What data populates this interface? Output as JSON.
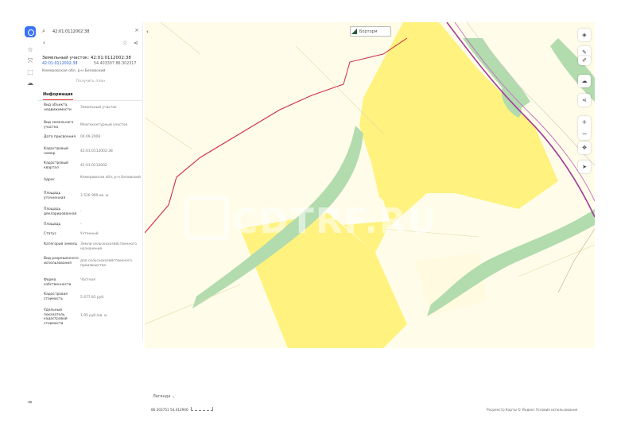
{
  "search": {
    "value": "42:01:0112002:38"
  },
  "parcel": {
    "title": "Земельный участок: 42:01:0112002:38",
    "number": "42:01:0112002:38",
    "coords": "54.403307 86.302317",
    "region": "Кемеровская обл, р-н Беловский",
    "action": "Получить план"
  },
  "tabs": {
    "info": "Информация"
  },
  "rows": [
    {
      "k": "Вид объекта недвижимости",
      "v": "Земельный участок"
    },
    {
      "k": "Вид земельного участка",
      "v": "Многоконтурный участок"
    },
    {
      "k": "Дата присвоения",
      "v": "04.09.2008"
    },
    {
      "k": "Кадастровый номер",
      "v": "42:01:0112002:38"
    },
    {
      "k": "Кадастровый квартал",
      "v": "42:01:0112002"
    },
    {
      "k": "Адрес",
      "v": "Кемеровская обл, р-н Беловский"
    },
    {
      "k": "Площадь уточненная",
      "v": "3 526 900 кв. м"
    },
    {
      "k": "Площадь декларированная",
      "v": "-"
    },
    {
      "k": "Площадь",
      "v": "-"
    },
    {
      "k": "Статус",
      "v": "Учтенный"
    },
    {
      "k": "Категория земель",
      "v": "Земли сельскохозяйственного назначения"
    },
    {
      "k": "Вид разрешенного использования",
      "v": "для сельскохозяйственного производства"
    },
    {
      "k": "Форма собственности",
      "v": "Частная"
    },
    {
      "k": "Кадастровая стоимость",
      "v": "5 677 81 руб."
    },
    {
      "k": "Удельный показатель кадастровой стоимости",
      "v": "1,95 руб./кв. м"
    }
  ],
  "map": {
    "tooltip": "Борторм",
    "watermark": "CDTRF.RU",
    "colors": {
      "parcel": "#fff27e",
      "forest": "#b2dbae",
      "boundary": "#d0284f",
      "road": "#a23a9c"
    }
  },
  "bottom": {
    "legend": "Легенда",
    "coords": "86.303751 54.412946",
    "attribution": "Росреестр   Карты © Яндекс   Условия использования"
  },
  "icons": [
    "logo-icon",
    "star-icon",
    "layers-icon",
    "ruler-icon",
    "share-icon",
    "location-icon",
    "exit-icon"
  ]
}
